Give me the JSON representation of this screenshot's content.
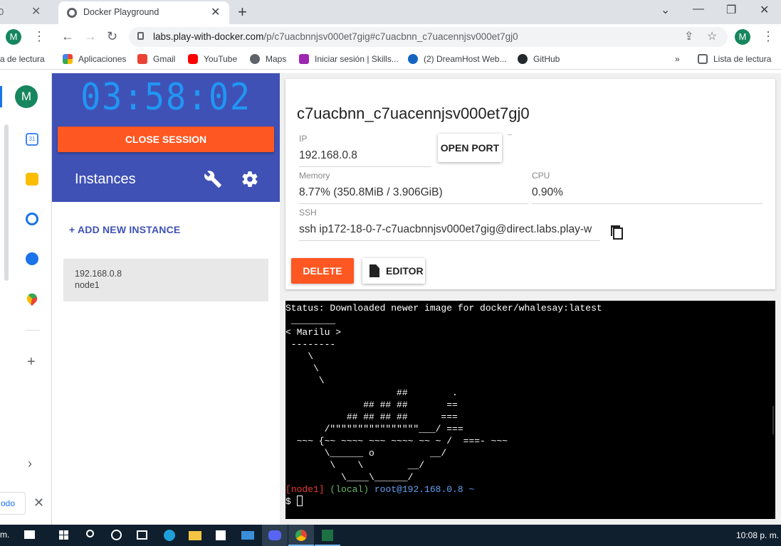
{
  "browser": {
    "prev_tab_fragment": "0",
    "active_tab_title": "Docker Playground",
    "url_host": "labs.play-with-docker.com",
    "url_path": "/p/c7uacbnnjsv000et7gig#c7uacbnn_c7uacennjsv000et7gj0",
    "profile_initial": "M",
    "bookmarks": [
      "a de lectura",
      "Aplicaciones",
      "Gmail",
      "YouTube",
      "Maps",
      "Iniciar sesión | Skills...",
      "(2) DreamHost Web...",
      "GitHub",
      "»",
      "Lista de lectura"
    ]
  },
  "sidepanel": {
    "avatar_initial": "M",
    "calendar_day": "31"
  },
  "session": {
    "timer": "03:58:02",
    "close_label": "CLOSE SESSION",
    "instances_title": "Instances",
    "add_instance_label": "+ ADD NEW INSTANCE",
    "instances": [
      {
        "ip": "192.168.0.8",
        "name": "node1"
      }
    ]
  },
  "instance": {
    "hostname": "c7uacbnn_c7uacennjsv000et7gj0",
    "ip_label": "IP",
    "ip_value": "192.168.0.8",
    "open_port_label": "OPEN PORT",
    "memory_label": "Memory",
    "memory_value": "8.77% (350.8MiB / 3.906GiB)",
    "cpu_label": "CPU",
    "cpu_value": "0.90%",
    "ssh_label": "SSH",
    "ssh_value": "ssh ip172-18-0-7-c7uacbnnjsv000et7gig@direct.labs.play-w",
    "delete_label": "DELETE",
    "editor_label": "EDITOR"
  },
  "terminal": {
    "output": "Status: Downloaded newer image for docker/whalesay:latest\n ________\n< Marilu >\n --------\n    \\\n     \\\n      \\\n                    ##        .\n              ## ## ##       ==\n           ## ## ## ##      ===\n       /\"\"\"\"\"\"\"\"\"\"\"\"\"\"\"\"___/ ===\n  ~~~ {~~ ~~~~ ~~~ ~~~~ ~~ ~ /  ===- ~~~\n       \\______ o          __/\n        \\    \\        __/\n          \\____\\______/",
    "prompt_node": "[node1]",
    "prompt_env": "(local)",
    "prompt_user": "root@192.168.0.8",
    "prompt_dir": "~",
    "prompt_symbol": "$"
  },
  "download": {
    "label": "odo"
  },
  "taskbar": {
    "left_text": "m.",
    "clock": "10:08 p. m."
  },
  "colors": {
    "pwd_blue": "#3f51b5",
    "timer_blue": "#2196f3",
    "action_orange": "#ff5722",
    "taskbar": "#101f2e"
  }
}
